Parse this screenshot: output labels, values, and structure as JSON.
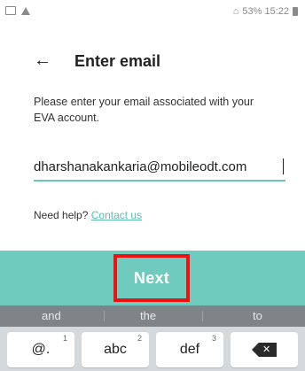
{
  "status_bar": {
    "right_text": "53% 15:22"
  },
  "header": {
    "back_icon": "arrow-left-icon",
    "title": "Enter email"
  },
  "description": "Please enter your email associated with your EVA account.",
  "email": {
    "value": "dharshanakankaria@mobileodt.com"
  },
  "help": {
    "prefix": "Need help?",
    "link": "Contact us"
  },
  "next_button": {
    "label": "Next"
  },
  "keyboard": {
    "suggestions": [
      "and",
      "the",
      "to"
    ],
    "keys": [
      {
        "label": "@.",
        "superscript": "1"
      },
      {
        "label": "abc",
        "superscript": "2"
      },
      {
        "label": "def",
        "superscript": "3"
      }
    ],
    "backspace_icon": "backspace-icon"
  },
  "colors": {
    "accent": "#6fcbbd",
    "highlight": "#e11111",
    "link": "#58bfb2"
  }
}
